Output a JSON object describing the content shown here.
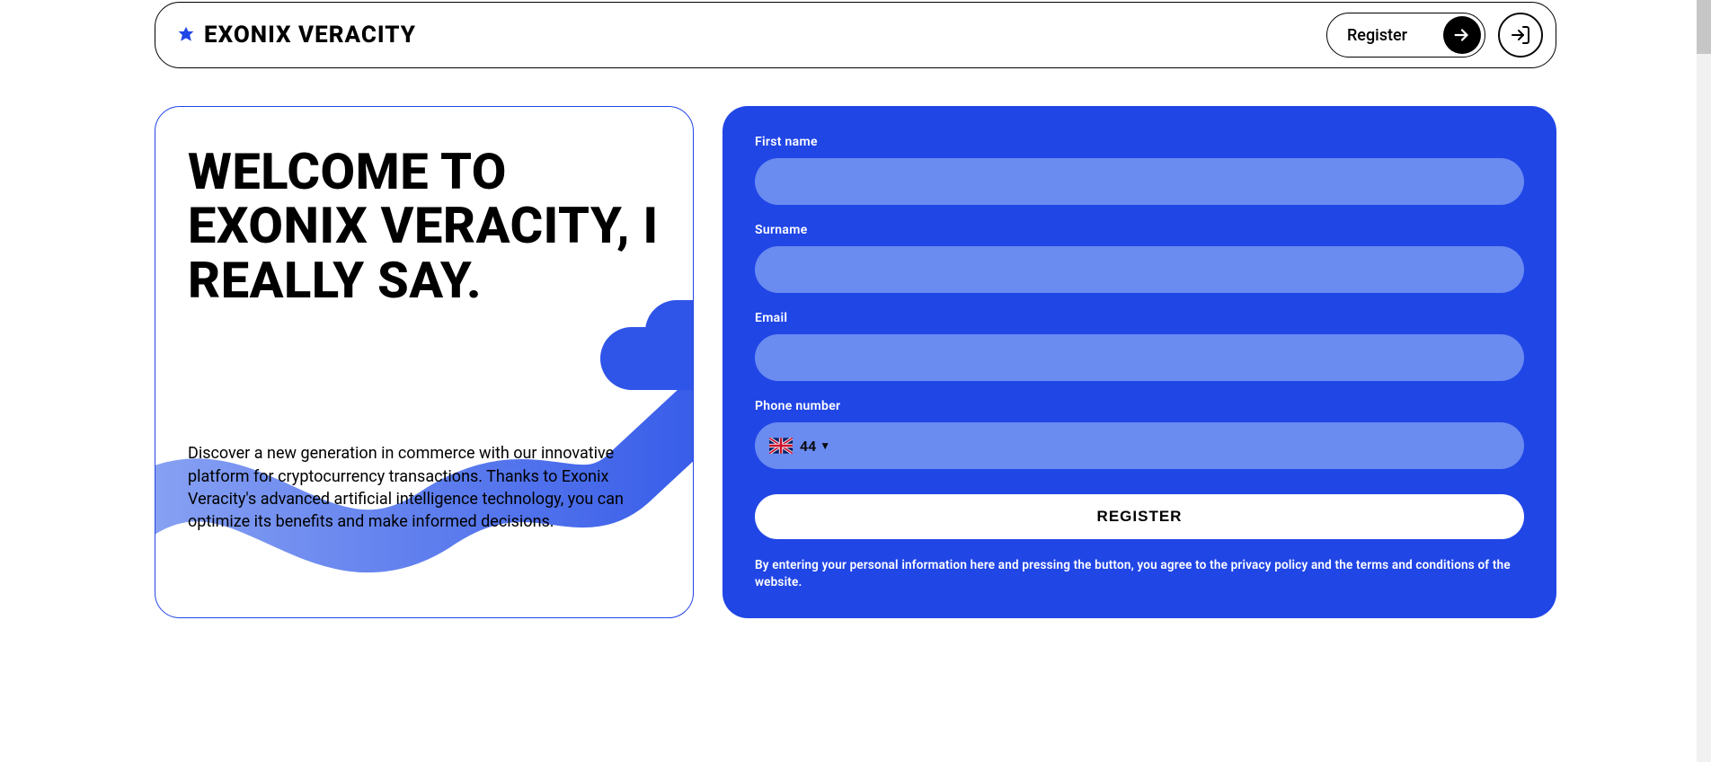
{
  "header": {
    "brand": "EXONIX VERACITY",
    "register_label": "Register"
  },
  "hero": {
    "title": "WELCOME TO EXONIX VERACITY, I REALLY SAY.",
    "description": "Discover a new generation in commerce with our innovative platform for cryptocurrency transactions. Thanks to Exonix Veracity's advanced artificial intelligence technology, you can optimize its benefits and make informed decisions."
  },
  "form": {
    "first_name_label": "First name",
    "surname_label": "Surname",
    "email_label": "Email",
    "phone_label": "Phone number",
    "phone_prefix": "44",
    "submit_label": "REGISTER",
    "disclaimer": "By entering your personal information here and pressing the button, you agree to the privacy policy and the terms and conditions of the website."
  },
  "colors": {
    "primary": "#2146e6",
    "input_bg": "#6a8bf0"
  }
}
